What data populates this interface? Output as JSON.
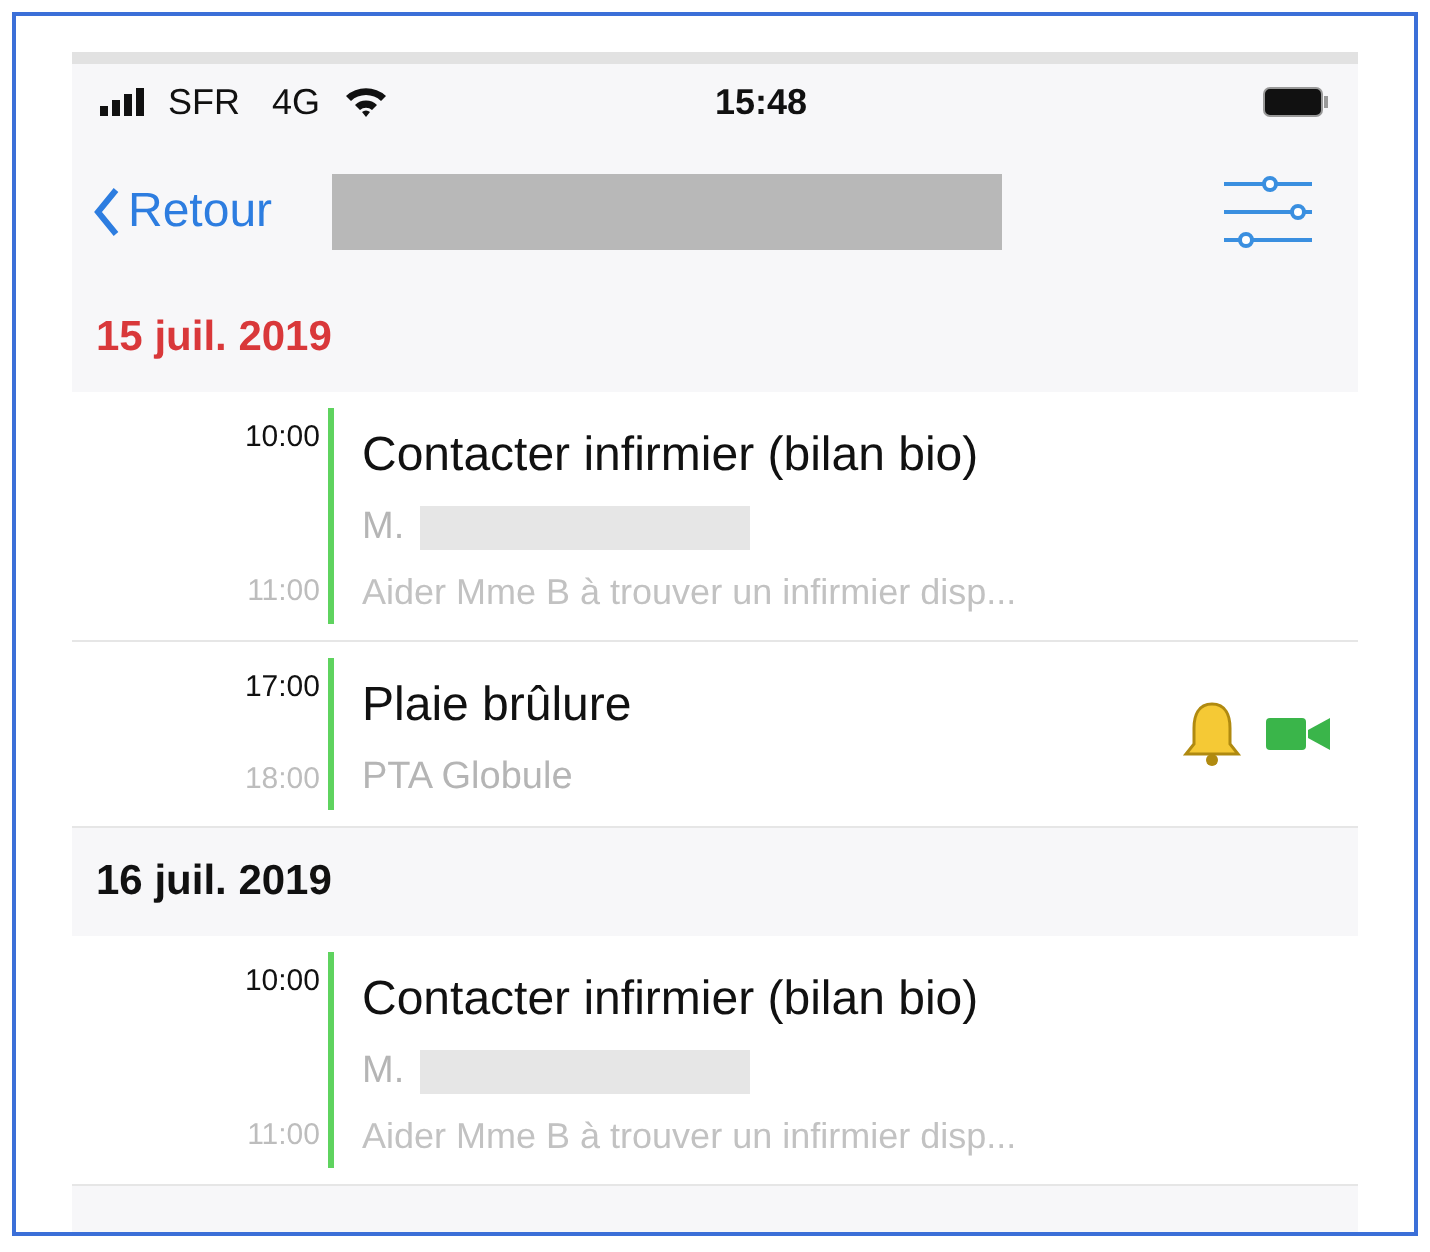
{
  "status_bar": {
    "carrier": "SFR",
    "network": "4G",
    "time": "15:48"
  },
  "nav": {
    "back": "Retour",
    "title_redacted": true
  },
  "sections": [
    {
      "date": "15 juil. 2019",
      "today": true,
      "events": [
        {
          "start": "10:00",
          "end": "11:00",
          "title": "Contacter infirmier (bilan bio)",
          "detail": "M.",
          "detail_redacted": true,
          "note": "Aider Mme B à trouver un infirmier disp...",
          "reminder": false,
          "video": false
        },
        {
          "start": "17:00",
          "end": "18:00",
          "title": "Plaie brûlure",
          "detail": "PTA Globule",
          "detail_redacted": false,
          "reminder": true,
          "video": true
        }
      ]
    },
    {
      "date": "16 juil. 2019",
      "today": false,
      "events": [
        {
          "start": "10:00",
          "end": "11:00",
          "title": "Contacter infirmier (bilan bio)",
          "detail": "M.",
          "detail_redacted": true,
          "note": "Aider Mme B à trouver un infirmier disp...",
          "reminder": false,
          "video": false
        }
      ]
    }
  ]
}
